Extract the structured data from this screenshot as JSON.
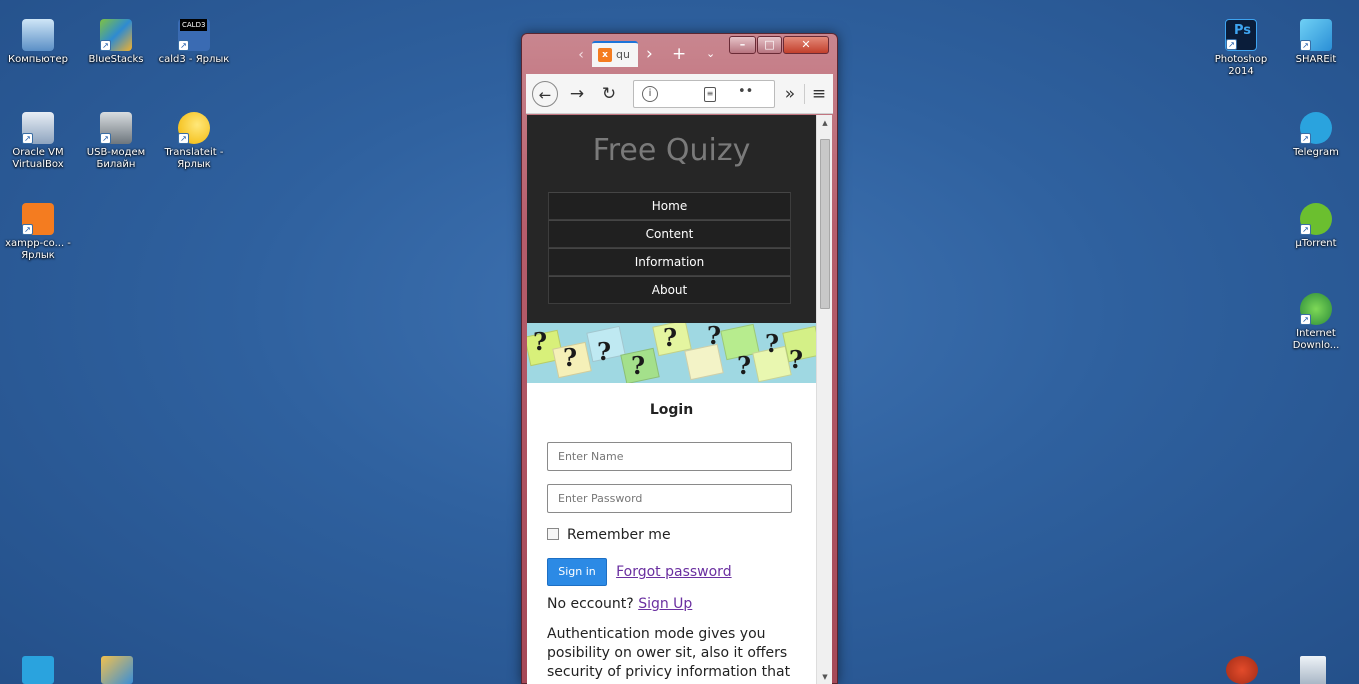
{
  "desktop": {
    "icons_left": [
      {
        "label": "Компьютер",
        "icon": "computer-icon"
      },
      {
        "label": "BlueStacks",
        "icon": "bluestacks-icon"
      },
      {
        "label": "cald3 - Ярлык",
        "icon": "cald3-icon",
        "badge": "CALD3"
      },
      {
        "label": "Oracle VM VirtualBox",
        "icon": "virtualbox-icon"
      },
      {
        "label": "USB-модем Билайн",
        "icon": "usb-modem-icon"
      },
      {
        "label": "Translateit - Ярлык",
        "icon": "translateit-icon"
      },
      {
        "label": "xampp-co... - Ярлык",
        "icon": "xampp-icon"
      }
    ],
    "icons_right": [
      {
        "label": "Photoshop 2014",
        "icon": "photoshop-icon",
        "badge": "Ps"
      },
      {
        "label": "SHAREit",
        "icon": "shareit-icon"
      },
      {
        "label": "Telegram",
        "icon": "telegram-icon"
      },
      {
        "label": "µTorrent",
        "icon": "utorrent-icon"
      },
      {
        "label": "Internet Downlo...",
        "icon": "idm-icon"
      }
    ]
  },
  "browser": {
    "tab_title": "qu",
    "url_placeholder": "",
    "colors": {
      "frame": "#b65d6c",
      "tab_accent": "#1c74d9"
    }
  },
  "site": {
    "title": "Free Quizy",
    "menu": [
      "Home",
      "Content",
      "Information",
      "About"
    ],
    "login": {
      "title": "Login",
      "name_placeholder": "Enter Name",
      "password_placeholder": "Enter Password",
      "remember_label": "Remember me",
      "signin_label": "Sign in",
      "forgot_label": "Forgot password",
      "no_account_text": "No eccount?",
      "signup_label": "Sign Up",
      "auth_text": "Authentication mode gives you posibility on ower sit, also it offers security of privicy information that"
    },
    "colors": {
      "header_bg": "#262626",
      "button": "#2c8ae5",
      "link": "#6a2fa0"
    }
  }
}
